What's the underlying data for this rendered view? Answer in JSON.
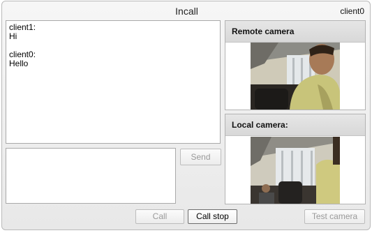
{
  "window": {
    "title": "Incall",
    "user": "client0"
  },
  "chat": {
    "messages": [
      {
        "sender": "client1:",
        "text": "Hi"
      },
      {
        "sender": "client0:",
        "text": "Hello"
      }
    ],
    "input_value": ""
  },
  "buttons": {
    "send": "Send",
    "call": "Call",
    "call_stop": "Call stop",
    "test_camera": "Test camera"
  },
  "remote_panel": {
    "title": "Remote camera"
  },
  "local_panel": {
    "title": "Local camera:"
  }
}
